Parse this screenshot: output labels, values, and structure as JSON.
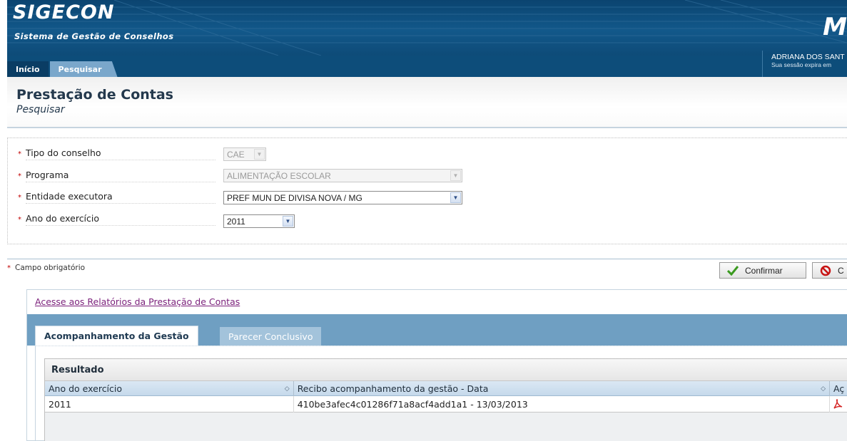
{
  "app": {
    "title": "SIGECON",
    "subtitle": "Sistema de Gestão de Conselhos",
    "brand_mark": "M"
  },
  "user": {
    "name": "ADRIANA DOS SANT",
    "session": "Sua sessão expira em"
  },
  "nav": {
    "items": [
      {
        "label": "Início",
        "active": false
      },
      {
        "label": "Pesquisar",
        "active": true
      }
    ]
  },
  "page": {
    "title": "Prestação de Contas",
    "subtitle": "Pesquisar"
  },
  "form": {
    "required_marker": "*",
    "fields": [
      {
        "label": "Tipo do conselho",
        "value": "CAE",
        "disabled": true
      },
      {
        "label": "Programa",
        "value": "ALIMENTAÇÃO ESCOLAR",
        "disabled": true
      },
      {
        "label": "Entidade executora",
        "value": "PREF MUN DE DIVISA NOVA / MG",
        "disabled": false
      },
      {
        "label": "Ano do exercício",
        "value": "2011",
        "disabled": false
      }
    ],
    "required_note": "Campo obrigatório"
  },
  "actions": {
    "confirm_label": "Confirmar",
    "cancel_label": "C"
  },
  "results": {
    "report_link": "Acesse aos Relatórios da Prestação de Contas",
    "tabs": [
      {
        "label": "Acompanhamento da Gestão",
        "active": true
      },
      {
        "label": "Parecer Conclusivo",
        "active": false
      }
    ],
    "grid": {
      "caption": "Resultado",
      "columns": [
        "Ano do exercício",
        "Recibo acompanhamento da gestão - Data",
        "Aç"
      ],
      "rows": [
        [
          "2011",
          "410be3afec4c01286f71a8acf4add1a1 - 13/03/2013",
          ""
        ]
      ]
    }
  },
  "colors": {
    "header_bg": "#0d4d7a",
    "tab_bar": "#6f9fc2",
    "required": "#c00000",
    "link_visited": "#7a1f7a"
  },
  "icons": [
    "check-icon",
    "cancel-icon",
    "pdf-icon",
    "sort-icon",
    "dropdown-icon"
  ]
}
